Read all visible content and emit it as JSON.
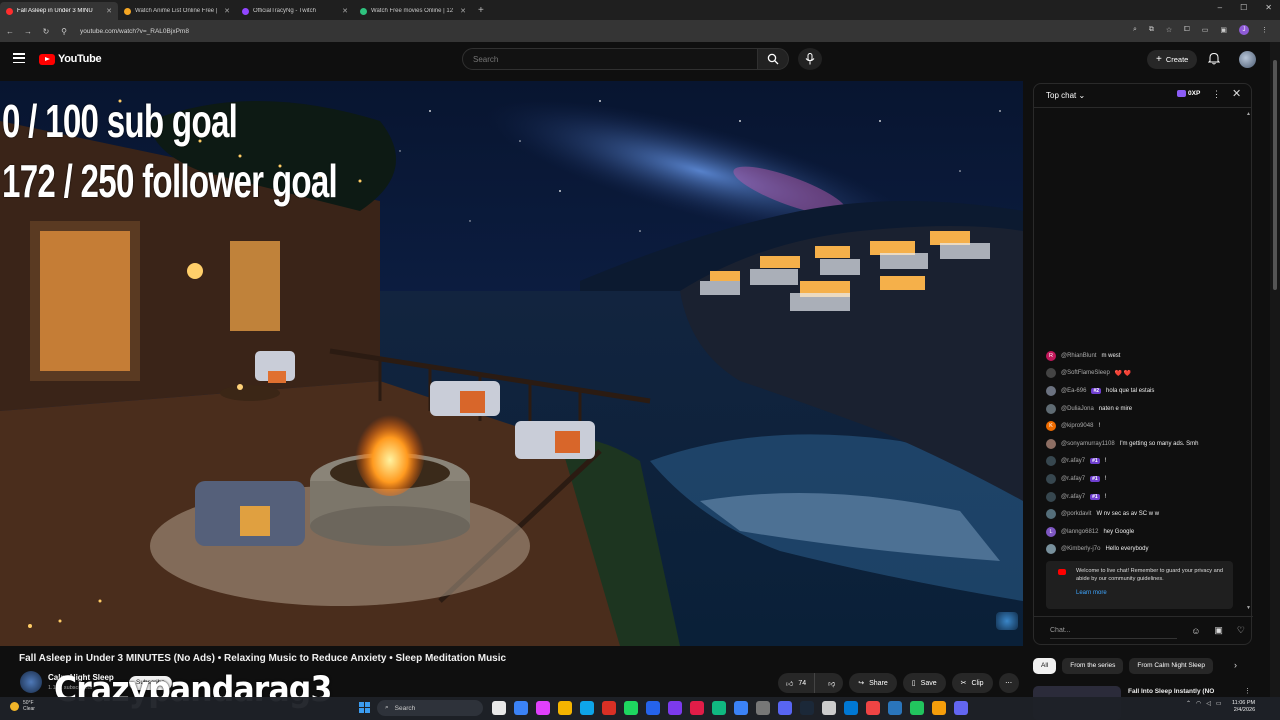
{
  "browser": {
    "tabs": [
      {
        "title": "Fall Asleep in Under 3 MINU",
        "color": "#ff2d2d",
        "active": true
      },
      {
        "title": "Watch Anime List Online Free |",
        "color": "#f5a623",
        "active": false
      },
      {
        "title": "OfficialTracyNg - Twitch",
        "color": "#9146ff",
        "active": false
      },
      {
        "title": "Watch Free movies Online | 12",
        "color": "#2ec27e",
        "active": false
      }
    ],
    "new_tab": "+",
    "url": "youtube.com/watch?v=_RAL0BjxPm8",
    "window_controls": [
      "–",
      "☐",
      "✕"
    ]
  },
  "youtube": {
    "logo_text": "YouTube",
    "search_placeholder": "Search",
    "create_label": "Create"
  },
  "video": {
    "overlay_line1": "0 / 100 sub goal",
    "overlay_line2": "172 / 250 follower goal",
    "title": "Fall Asleep in Under 3 MINUTES (No Ads) • Relaxing Music to Reduce Anxiety • Sleep Meditation Music",
    "channel_name": "Calm Night Sleep",
    "channel_subs": "1.13K subscribers",
    "subscribe_label": "Subscribe",
    "watermark": "Crazypandarag3",
    "like_count": "74",
    "share_label": "Share",
    "save_label": "Save",
    "clip_label": "Clip"
  },
  "chat": {
    "header_label": "Top chat",
    "xp_label": "0XP",
    "messages": [
      {
        "initial": "R",
        "avatar_color": "#c2185b",
        "user": "@RhianBlunt",
        "badge": "",
        "text": "m west"
      },
      {
        "initial": "",
        "avatar_color": "#444444",
        "user": "@SoftFlameSleep",
        "badge": "",
        "text": "❤️ ❤️"
      },
      {
        "initial": "",
        "avatar_color": "#6b7280",
        "user": "@Ea-696",
        "badge": "#2",
        "text": "hola que tal estais"
      },
      {
        "initial": "",
        "avatar_color": "#5f6b73",
        "user": "@DuliaJona",
        "badge": "",
        "text": "naten e mire"
      },
      {
        "initial": "K",
        "avatar_color": "#ef6c00",
        "user": "@kipro9048",
        "badge": "",
        "text": "!"
      },
      {
        "initial": "",
        "avatar_color": "#8d6e63",
        "user": "@sonyamurray1108",
        "badge": "",
        "text": "I'm getting so many ads. Smh"
      },
      {
        "initial": "",
        "avatar_color": "#37474f",
        "user": "@r.afay7",
        "badge": "#1",
        "text": "!"
      },
      {
        "initial": "",
        "avatar_color": "#37474f",
        "user": "@r.afay7",
        "badge": "#1",
        "text": "!"
      },
      {
        "initial": "",
        "avatar_color": "#37474f",
        "user": "@r.afay7",
        "badge": "#1",
        "text": "!"
      },
      {
        "initial": "",
        "avatar_color": "#546e7a",
        "user": "@porkdavit",
        "badge": "",
        "text": "W nv sec as av SC w w"
      },
      {
        "initial": "L",
        "avatar_color": "#7e57c2",
        "user": "@lanngo6812",
        "badge": "",
        "text": "hey Google"
      },
      {
        "initial": "",
        "avatar_color": "#78909c",
        "user": "@Kimberly-j7o",
        "badge": "",
        "text": "Hello everybody"
      }
    ],
    "welcome_text": "Welcome to live chat! Remember to guard your privacy and abide by our community guidelines.",
    "learn_more": "Learn more",
    "input_placeholder": "Chat..."
  },
  "recommendations": {
    "chips": [
      "All",
      "From the series",
      "From Calm Night Sleep"
    ],
    "first_title": "Fall Into Sleep Instantly (NO"
  },
  "taskbar": {
    "weather_temp": "50°F",
    "weather_desc": "Clear",
    "search_label": "Search",
    "time": "11:06 PM",
    "date": "2/4/2026",
    "app_colors": [
      "#e8e8e8",
      "#3b82f6",
      "#e040fb",
      "#f4b400",
      "#0ea5e9",
      "#d93025",
      "#1ed760",
      "#2563eb",
      "#7c3aed",
      "#e11d48",
      "#10b981",
      "#3b82f6",
      "#777777",
      "#5865f2",
      "#1b2838",
      "#cccccc",
      "#0078d4",
      "#ef4444",
      "#2a75bb",
      "#22c55e",
      "#f59e0b",
      "#6366f1"
    ]
  }
}
